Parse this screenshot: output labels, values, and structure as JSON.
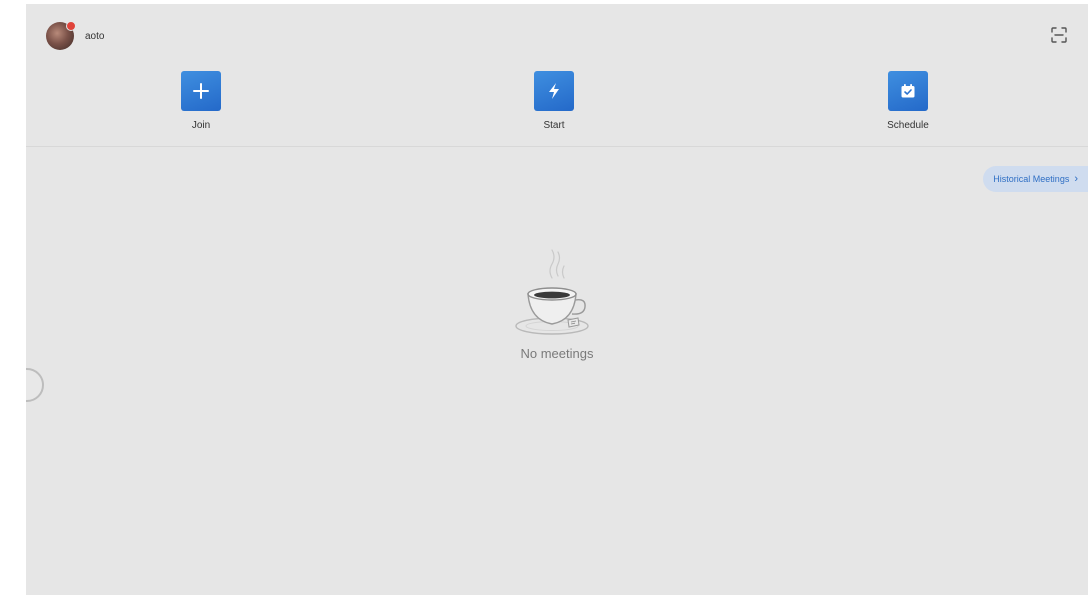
{
  "user": {
    "name": "aoto"
  },
  "actions": {
    "join": {
      "label": "Join",
      "icon": "plus-icon"
    },
    "start": {
      "label": "Start",
      "icon": "lightning-icon"
    },
    "schedule": {
      "label": "Schedule",
      "icon": "calendar-check-icon"
    }
  },
  "history": {
    "label": "Historical Meetings",
    "icon": "chevron-right-icon"
  },
  "empty_state": {
    "icon": "coffee-cup-icon",
    "message": "No meetings"
  },
  "colors": {
    "accent": "#2a72d0",
    "background": "#e6e6e6",
    "history_bg": "#cfdcef",
    "history_text": "#2f6fc4",
    "notification_dot": "#e0433a"
  }
}
